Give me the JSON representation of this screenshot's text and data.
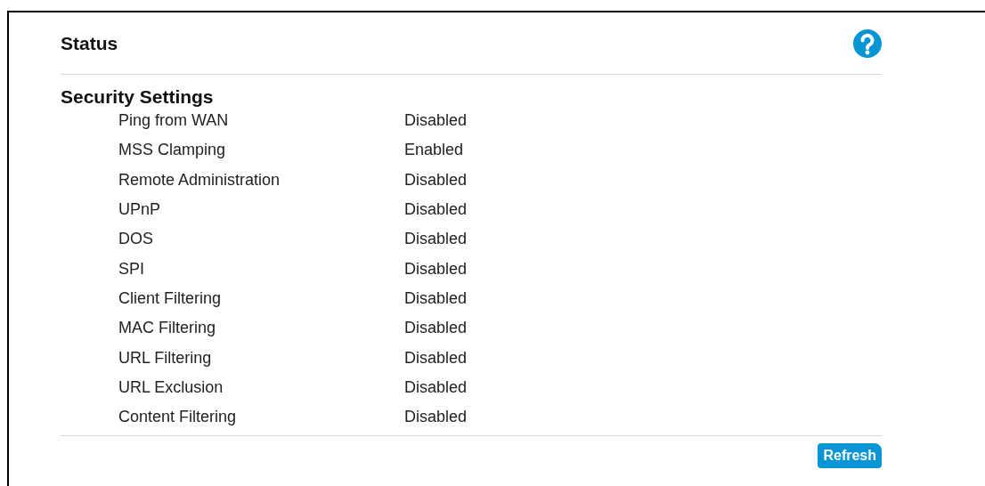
{
  "title": "Status",
  "section": {
    "heading": "Security Settings",
    "rows": [
      {
        "label": "Ping from WAN",
        "value": "Disabled"
      },
      {
        "label": "MSS Clamping",
        "value": "Enabled"
      },
      {
        "label": "Remote Administration",
        "value": "Disabled"
      },
      {
        "label": "UPnP",
        "value": "Disabled"
      },
      {
        "label": "DOS",
        "value": "Disabled"
      },
      {
        "label": "SPI",
        "value": "Disabled"
      },
      {
        "label": "Client Filtering",
        "value": "Disabled"
      },
      {
        "label": "MAC Filtering",
        "value": "Disabled"
      },
      {
        "label": "URL Filtering",
        "value": "Disabled"
      },
      {
        "label": "URL Exclusion",
        "value": "Disabled"
      },
      {
        "label": "Content Filtering",
        "value": "Disabled"
      }
    ]
  },
  "buttons": [
    "Refresh"
  ]
}
